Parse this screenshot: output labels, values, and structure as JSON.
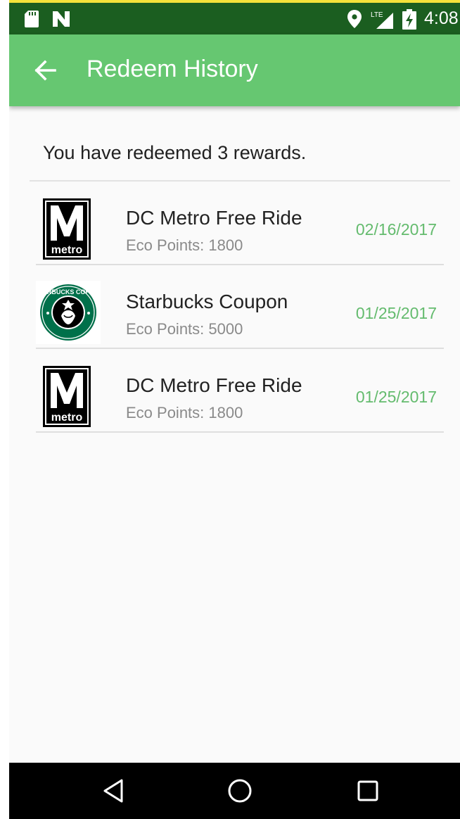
{
  "status_bar": {
    "time": "4:08",
    "network_label": "LTE",
    "icons": [
      "sd-card-icon",
      "n-notification-icon",
      "location-icon",
      "lte-signal-icon",
      "battery-charging-icon"
    ]
  },
  "app_bar": {
    "title": "Redeem History",
    "back_icon": "arrow-back-icon"
  },
  "summary": "You have redeemed 3 rewards.",
  "rewards": [
    {
      "name": "DC Metro Free Ride",
      "points": "Eco Points: 1800",
      "date": "02/16/2017",
      "logo": "metro-logo",
      "logo_text": "metro"
    },
    {
      "name": "Starbucks Coupon",
      "points": "Eco Points: 5000",
      "date": "01/25/2017",
      "logo": "starbucks-logo",
      "logo_text": "STARBUCKS COFFEE"
    },
    {
      "name": "DC Metro Free Ride",
      "points": "Eco Points: 1800",
      "date": "01/25/2017",
      "logo": "metro-logo",
      "logo_text": "metro"
    }
  ],
  "nav_bar": {
    "buttons": [
      "back-triangle-icon",
      "home-circle-icon",
      "recents-square-icon"
    ]
  },
  "colors": {
    "status_bar": "#1b5e20",
    "app_bar": "#66c771",
    "date_text": "#64bb6e",
    "background": "#fafafa"
  }
}
